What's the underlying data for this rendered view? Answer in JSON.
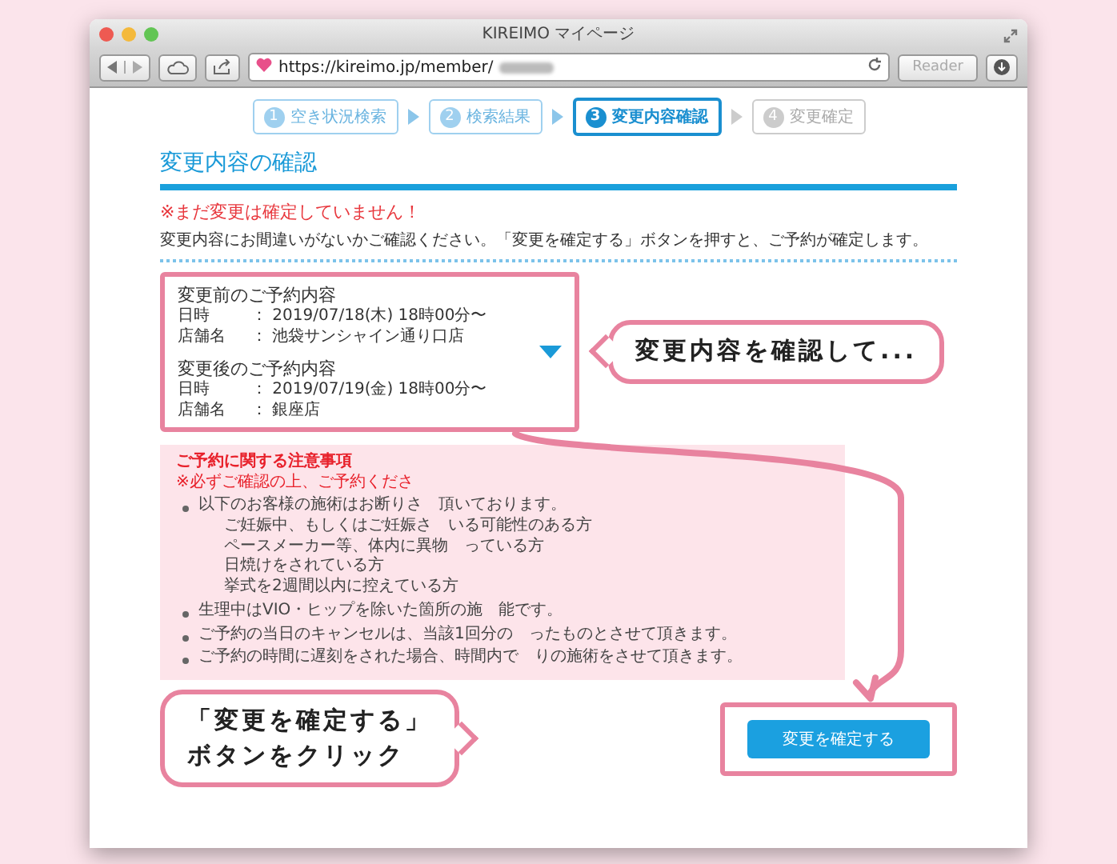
{
  "window": {
    "title": "KIREIMO マイページ"
  },
  "toolbar": {
    "url": "https://kireimo.jp/member/",
    "reader": "Reader"
  },
  "steps": [
    {
      "number": "1",
      "label": "空き状況検索",
      "completed": true,
      "current": false
    },
    {
      "number": "2",
      "label": "検索結果",
      "completed": true,
      "current": false
    },
    {
      "number": "3",
      "label": "変更内容確認",
      "completed": false,
      "current": true
    },
    {
      "number": "4",
      "label": "変更確定",
      "completed": false,
      "current": false
    }
  ],
  "heading": "変更内容の確認",
  "warning": "※まだ変更は確定していません！",
  "description": "変更内容にお間違いがないかご確認ください。「変更を確定する」ボタンを押すと、ご予約が確定します。",
  "reservations": [
    {
      "title": "変更前のご予約内容",
      "rows": [
        {
          "label": "日時",
          "value": "： 2019/07/18(木) 18時00分〜"
        },
        {
          "label": "店舗名",
          "value": "： 池袋サンシャイン通り口店"
        }
      ]
    },
    {
      "title": "変更後のご予約内容",
      "rows": [
        {
          "label": "日時",
          "value": "： 2019/07/19(金) 18時00分〜"
        },
        {
          "label": "店舗名",
          "value": "： 銀座店"
        }
      ]
    }
  ],
  "callouts": [
    {
      "lines": [
        "変更内容を確認して..."
      ]
    },
    {
      "lines": [
        "「変更を確定する」",
        "ボタンをクリック"
      ]
    }
  ],
  "notice": {
    "title": "ご予約に関する注意事項",
    "subtitle": "※必ずご確認の上、ご予約くださ",
    "items": [
      {
        "text": "以下のお客様の施術はお断りさ　頂いております。",
        "children": [
          {
            "text": "ご妊娠中、もしくはご妊娠さ　いる可能性のある方"
          },
          {
            "text": "ペースメーカー等、体内に異物　っている方"
          },
          {
            "text": "日焼けをされている方"
          },
          {
            "text": "挙式を2週間以内に控えている方"
          }
        ]
      },
      {
        "text": "生理中はVIO・ヒップを除いた箇所の施　能です。"
      },
      {
        "text": "ご予約の当日のキャンセルは、当該1回分の　ったものとさせて頂きます。"
      },
      {
        "text": "ご予約の時間に遅刻をされた場合、時間内で　りの施術をさせて頂きます。"
      }
    ]
  },
  "confirm_button": "変更を確定する"
}
